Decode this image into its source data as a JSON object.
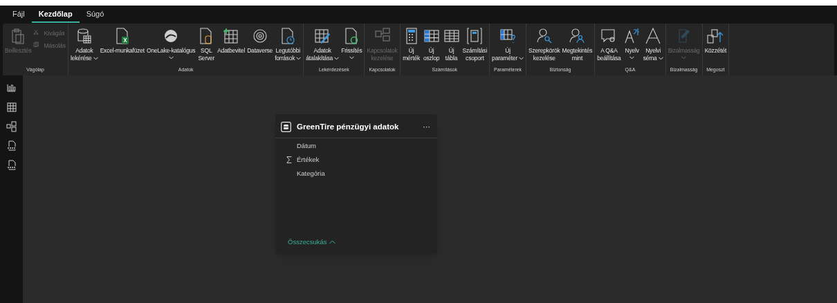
{
  "menu": [
    {
      "label": "Fájl",
      "selected": false
    },
    {
      "label": "Kezdőlap",
      "selected": true
    },
    {
      "label": "Súgó",
      "selected": false
    }
  ],
  "ribbon": [
    {
      "label": "Vágólap",
      "buttons": [
        {
          "kind": "large",
          "lines": [
            "Beillesztés"
          ],
          "dropdown": false,
          "disabled": true
        },
        {
          "kind": "small",
          "lines": [
            "Kivágás"
          ],
          "dropdown": false,
          "disabled": true
        },
        {
          "kind": "small",
          "lines": [
            "Másolás"
          ],
          "dropdown": false,
          "disabled": true
        }
      ]
    },
    {
      "label": "Adatok",
      "buttons": [
        {
          "kind": "large",
          "lines": [
            "Adatok",
            "lekérése"
          ],
          "dropdown": true,
          "disabled": false
        },
        {
          "kind": "large",
          "lines": [
            "Excel-munkafüzet"
          ],
          "dropdown": false,
          "disabled": false
        },
        {
          "kind": "large",
          "lines": [
            "OneLake-katalógus"
          ],
          "dropdown": true,
          "disabled": false
        },
        {
          "kind": "large",
          "lines": [
            "SQL",
            "Server"
          ],
          "dropdown": false,
          "disabled": false
        },
        {
          "kind": "large",
          "lines": [
            "Adatbevitel"
          ],
          "dropdown": false,
          "disabled": false
        },
        {
          "kind": "large",
          "lines": [
            "Dataverse"
          ],
          "dropdown": false,
          "disabled": false
        },
        {
          "kind": "large",
          "lines": [
            "Legutóbbi",
            "források"
          ],
          "dropdown": true,
          "disabled": false
        }
      ]
    },
    {
      "label": "Lekérdezések",
      "buttons": [
        {
          "kind": "large",
          "lines": [
            "Adatok",
            "átalakítása"
          ],
          "dropdown": true,
          "disabled": false
        },
        {
          "kind": "large",
          "lines": [
            "Frissítés"
          ],
          "dropdown": true,
          "disabled": false
        }
      ]
    },
    {
      "label": "Kapcsolatok",
      "buttons": [
        {
          "kind": "large",
          "lines": [
            "Kapcsolatok",
            "kezelése"
          ],
          "dropdown": false,
          "disabled": true
        }
      ]
    },
    {
      "label": "Számítások",
      "buttons": [
        {
          "kind": "large",
          "lines": [
            "Új",
            "mérték"
          ],
          "dropdown": false,
          "disabled": false
        },
        {
          "kind": "large",
          "lines": [
            "Új",
            "oszlop"
          ],
          "dropdown": false,
          "disabled": false
        },
        {
          "kind": "large",
          "lines": [
            "Új",
            "tábla"
          ],
          "dropdown": false,
          "disabled": false
        },
        {
          "kind": "large",
          "lines": [
            "Számítási",
            "csoport"
          ],
          "dropdown": false,
          "disabled": false
        }
      ]
    },
    {
      "label": "Paraméterek",
      "buttons": [
        {
          "kind": "large",
          "lines": [
            "Új",
            "paraméter"
          ],
          "dropdown": true,
          "disabled": false
        }
      ]
    },
    {
      "label": "Biztonság",
      "buttons": [
        {
          "kind": "large",
          "lines": [
            "Szerepkörök",
            "kezelése"
          ],
          "dropdown": false,
          "disabled": false
        },
        {
          "kind": "large",
          "lines": [
            "Megtekintés",
            "mint"
          ],
          "dropdown": false,
          "disabled": false
        }
      ]
    },
    {
      "label": "Q&A",
      "buttons": [
        {
          "kind": "large",
          "lines": [
            "A Q&A",
            "beállítása"
          ],
          "dropdown": false,
          "disabled": false
        },
        {
          "kind": "large",
          "lines": [
            "Nyelv"
          ],
          "dropdown": true,
          "disabled": false
        },
        {
          "kind": "large",
          "lines": [
            "Nyelvi",
            "séma"
          ],
          "dropdown": true,
          "disabled": false
        }
      ]
    },
    {
      "label": "Bizalmasság",
      "buttons": [
        {
          "kind": "large",
          "lines": [
            "Bizalmasság"
          ],
          "dropdown": true,
          "disabled": true
        }
      ]
    },
    {
      "label": "Megoszt",
      "buttons": [
        {
          "kind": "large",
          "lines": [
            "Közzétét"
          ],
          "dropdown": false,
          "disabled": false
        }
      ]
    }
  ],
  "table_card": {
    "title": "GreenTire pénzügyi adatok",
    "more": "···",
    "fields": [
      {
        "label": "Dátum",
        "kind": "column"
      },
      {
        "label": "Értékek",
        "kind": "measure"
      },
      {
        "label": "Kategória",
        "kind": "column"
      }
    ],
    "collapse": "Összecsukás"
  }
}
